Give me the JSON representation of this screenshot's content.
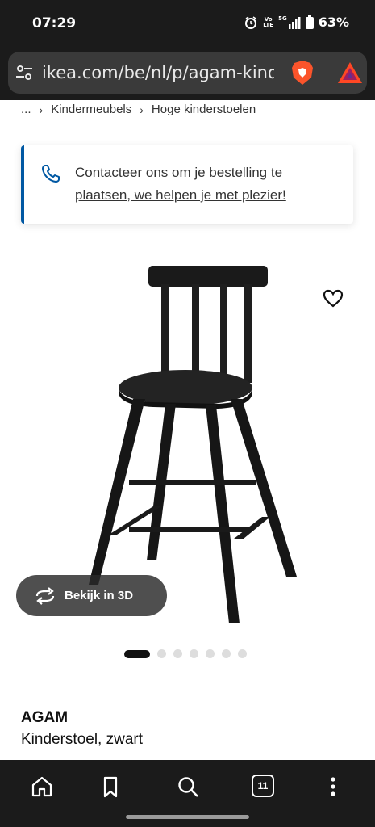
{
  "status": {
    "time": "07:29",
    "battery": "63%",
    "vo": "Vo",
    "lte": "LTE",
    "fiveg": "5G"
  },
  "browser": {
    "url": "ikea.com/be/nl/p/agam-kinder",
    "tab_count": "11"
  },
  "breadcrumb": {
    "ellipsis": "...",
    "items": [
      "Kindermeubels",
      "Hoge kinderstoelen"
    ]
  },
  "contact": {
    "message": "Contacteer ons om je bestelling te plaatsen, we helpen je met plezier!"
  },
  "gallery": {
    "view3d_label": "Bekijk in 3D",
    "dot_count": 7,
    "active_dot": 1
  },
  "product": {
    "name": "AGAM",
    "description": "Kinderstoel, zwart"
  },
  "colors": {
    "status_bg": "#1b1b1b",
    "url_bar": "#3a3a3a",
    "ikea_blue": "#0058a3",
    "brave_orange": "#fb542b"
  }
}
